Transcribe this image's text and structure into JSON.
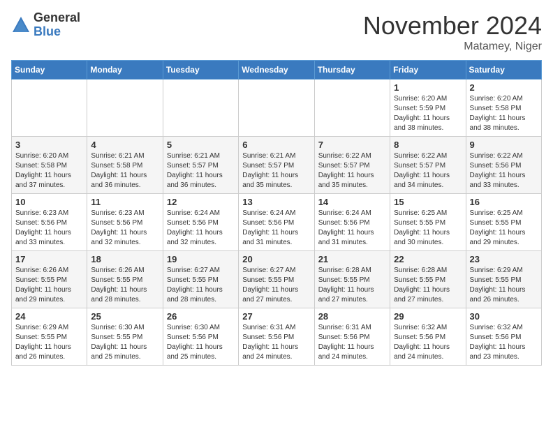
{
  "logo": {
    "general": "General",
    "blue": "Blue"
  },
  "header": {
    "month": "November 2024",
    "location": "Matamey, Niger"
  },
  "weekdays": [
    "Sunday",
    "Monday",
    "Tuesday",
    "Wednesday",
    "Thursday",
    "Friday",
    "Saturday"
  ],
  "weeks": [
    [
      {
        "day": "",
        "info": ""
      },
      {
        "day": "",
        "info": ""
      },
      {
        "day": "",
        "info": ""
      },
      {
        "day": "",
        "info": ""
      },
      {
        "day": "",
        "info": ""
      },
      {
        "day": "1",
        "info": "Sunrise: 6:20 AM\nSunset: 5:59 PM\nDaylight: 11 hours and 38 minutes."
      },
      {
        "day": "2",
        "info": "Sunrise: 6:20 AM\nSunset: 5:58 PM\nDaylight: 11 hours and 38 minutes."
      }
    ],
    [
      {
        "day": "3",
        "info": "Sunrise: 6:20 AM\nSunset: 5:58 PM\nDaylight: 11 hours and 37 minutes."
      },
      {
        "day": "4",
        "info": "Sunrise: 6:21 AM\nSunset: 5:58 PM\nDaylight: 11 hours and 36 minutes."
      },
      {
        "day": "5",
        "info": "Sunrise: 6:21 AM\nSunset: 5:57 PM\nDaylight: 11 hours and 36 minutes."
      },
      {
        "day": "6",
        "info": "Sunrise: 6:21 AM\nSunset: 5:57 PM\nDaylight: 11 hours and 35 minutes."
      },
      {
        "day": "7",
        "info": "Sunrise: 6:22 AM\nSunset: 5:57 PM\nDaylight: 11 hours and 35 minutes."
      },
      {
        "day": "8",
        "info": "Sunrise: 6:22 AM\nSunset: 5:57 PM\nDaylight: 11 hours and 34 minutes."
      },
      {
        "day": "9",
        "info": "Sunrise: 6:22 AM\nSunset: 5:56 PM\nDaylight: 11 hours and 33 minutes."
      }
    ],
    [
      {
        "day": "10",
        "info": "Sunrise: 6:23 AM\nSunset: 5:56 PM\nDaylight: 11 hours and 33 minutes."
      },
      {
        "day": "11",
        "info": "Sunrise: 6:23 AM\nSunset: 5:56 PM\nDaylight: 11 hours and 32 minutes."
      },
      {
        "day": "12",
        "info": "Sunrise: 6:24 AM\nSunset: 5:56 PM\nDaylight: 11 hours and 32 minutes."
      },
      {
        "day": "13",
        "info": "Sunrise: 6:24 AM\nSunset: 5:56 PM\nDaylight: 11 hours and 31 minutes."
      },
      {
        "day": "14",
        "info": "Sunrise: 6:24 AM\nSunset: 5:56 PM\nDaylight: 11 hours and 31 minutes."
      },
      {
        "day": "15",
        "info": "Sunrise: 6:25 AM\nSunset: 5:55 PM\nDaylight: 11 hours and 30 minutes."
      },
      {
        "day": "16",
        "info": "Sunrise: 6:25 AM\nSunset: 5:55 PM\nDaylight: 11 hours and 29 minutes."
      }
    ],
    [
      {
        "day": "17",
        "info": "Sunrise: 6:26 AM\nSunset: 5:55 PM\nDaylight: 11 hours and 29 minutes."
      },
      {
        "day": "18",
        "info": "Sunrise: 6:26 AM\nSunset: 5:55 PM\nDaylight: 11 hours and 28 minutes."
      },
      {
        "day": "19",
        "info": "Sunrise: 6:27 AM\nSunset: 5:55 PM\nDaylight: 11 hours and 28 minutes."
      },
      {
        "day": "20",
        "info": "Sunrise: 6:27 AM\nSunset: 5:55 PM\nDaylight: 11 hours and 27 minutes."
      },
      {
        "day": "21",
        "info": "Sunrise: 6:28 AM\nSunset: 5:55 PM\nDaylight: 11 hours and 27 minutes."
      },
      {
        "day": "22",
        "info": "Sunrise: 6:28 AM\nSunset: 5:55 PM\nDaylight: 11 hours and 27 minutes."
      },
      {
        "day": "23",
        "info": "Sunrise: 6:29 AM\nSunset: 5:55 PM\nDaylight: 11 hours and 26 minutes."
      }
    ],
    [
      {
        "day": "24",
        "info": "Sunrise: 6:29 AM\nSunset: 5:55 PM\nDaylight: 11 hours and 26 minutes."
      },
      {
        "day": "25",
        "info": "Sunrise: 6:30 AM\nSunset: 5:55 PM\nDaylight: 11 hours and 25 minutes."
      },
      {
        "day": "26",
        "info": "Sunrise: 6:30 AM\nSunset: 5:56 PM\nDaylight: 11 hours and 25 minutes."
      },
      {
        "day": "27",
        "info": "Sunrise: 6:31 AM\nSunset: 5:56 PM\nDaylight: 11 hours and 24 minutes."
      },
      {
        "day": "28",
        "info": "Sunrise: 6:31 AM\nSunset: 5:56 PM\nDaylight: 11 hours and 24 minutes."
      },
      {
        "day": "29",
        "info": "Sunrise: 6:32 AM\nSunset: 5:56 PM\nDaylight: 11 hours and 24 minutes."
      },
      {
        "day": "30",
        "info": "Sunrise: 6:32 AM\nSunset: 5:56 PM\nDaylight: 11 hours and 23 minutes."
      }
    ]
  ]
}
